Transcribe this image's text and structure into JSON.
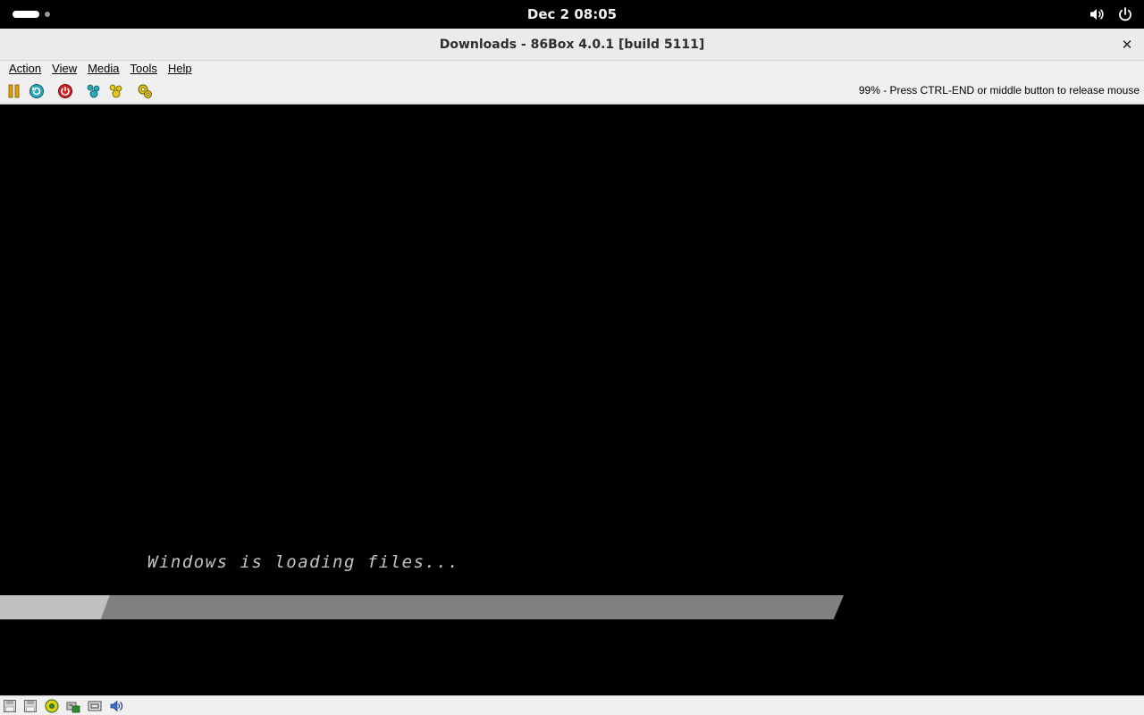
{
  "topbar": {
    "clock": "Dec 2  08:05",
    "icons": [
      "activities-indicator",
      "volume-icon",
      "power-icon"
    ]
  },
  "window": {
    "title": "Downloads - 86Box 4.0.1 [build 5111]",
    "close_label": "✕"
  },
  "menubar": {
    "items": [
      "Action",
      "View",
      "Media",
      "Tools",
      "Help"
    ]
  },
  "toolbar": {
    "buttons": [
      "pause-icon",
      "reset-icon",
      "power-off-icon",
      "ctrl-alt-del-icon",
      "ctrl-alt-esc-icon",
      "settings-icon"
    ],
    "status_message": "99% - Press CTRL-END or middle button to release mouse"
  },
  "screen": {
    "loading_text": "Windows is loading files...",
    "progress_fraction": 0.13
  },
  "statusbar": {
    "icons": [
      "floppy-a-icon",
      "floppy-b-icon",
      "cdrom-icon",
      "hard-disk-icon",
      "network-icon",
      "sound-icon"
    ]
  },
  "colors": {
    "screen_bg": "#000000",
    "loading_text": "#c4c4c4",
    "progress_track": "#808080",
    "progress_fill": "#c0c0c0"
  }
}
